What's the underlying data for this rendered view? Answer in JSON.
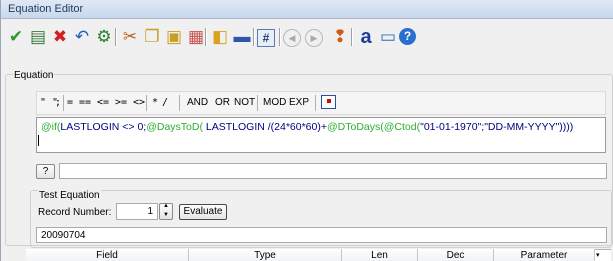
{
  "window": {
    "title": "Equation Editor"
  },
  "toolbar": {
    "buttons": [
      {
        "name": "ok-check-icon",
        "glyph": "✔",
        "color": "#2c9a2c"
      },
      {
        "name": "open-doc-icon",
        "glyph": "▤",
        "color": "#3a7a3a"
      },
      {
        "name": "cancel-x-icon",
        "glyph": "✖",
        "color": "#d02020"
      },
      {
        "name": "undo-icon",
        "glyph": "↶",
        "color": "#1f5fbf"
      },
      {
        "name": "tools-icon",
        "glyph": "⚙",
        "color": "#2e7d2e"
      },
      {
        "name": "cut-icon",
        "glyph": "✂",
        "color": "#b9651a"
      },
      {
        "name": "copy-icon",
        "glyph": "❐",
        "color": "#c8a020"
      },
      {
        "name": "paste-icon",
        "glyph": "▣",
        "color": "#c8a020"
      },
      {
        "name": "paste-special-icon",
        "glyph": "▦",
        "color": "#c85050"
      },
      {
        "name": "folder-open-icon",
        "glyph": "◧",
        "color": "#d9a320"
      },
      {
        "name": "save-icon",
        "glyph": "▬",
        "color": "#2d55a8"
      },
      {
        "name": "hash-icon",
        "glyph": "#",
        "color": "#1d3d7a"
      },
      {
        "name": "back-icon",
        "glyph": "◀",
        "color": "#a8a8a8"
      },
      {
        "name": "forward-icon",
        "glyph": "▶",
        "color": "#a8a8a8"
      },
      {
        "name": "bulb-icon",
        "glyph": "❢",
        "color": "#d05a1a"
      },
      {
        "name": "font-icon",
        "glyph": "a",
        "color": "#1d3d9a"
      },
      {
        "name": "window-icon",
        "glyph": "▭",
        "color": "#2e70b8"
      },
      {
        "name": "help-icon",
        "glyph": "?",
        "color": "#1f5fcf"
      }
    ]
  },
  "equation": {
    "group_label": "Equation",
    "operators": [
      "\" \"",
      ";",
      "=",
      "==",
      "<=",
      ">=",
      "<>",
      "*",
      "/",
      "AND",
      "OR",
      "NOT",
      "MOD",
      "EXP"
    ],
    "text_parts": [
      {
        "t": "@if(",
        "c": "fn"
      },
      {
        "t": "LASTLOGIN <> 0;",
        "c": "str"
      },
      {
        "t": "@DaysToD(",
        "c": "fn"
      },
      {
        "t": " LASTLOGIN /(24*60*60)+",
        "c": "str"
      },
      {
        "t": "@DToDays(",
        "c": "fn"
      },
      {
        "t": "@Ctod(",
        "c": "fn"
      },
      {
        "t": "\"01-01-1970\";\"DD-MM-YYYY\"))))",
        "c": "str"
      }
    ],
    "help_button_label": "?"
  },
  "test": {
    "group_label": "Test Equation",
    "record_label": "Record Number:",
    "record_value": "1",
    "evaluate_label": "Evaluate",
    "result": "20090704"
  },
  "grid": {
    "columns": [
      "Field",
      "Type",
      "Len",
      "Dec",
      "Parameter"
    ]
  }
}
